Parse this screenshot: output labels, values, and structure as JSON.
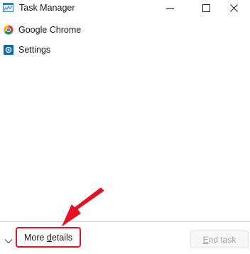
{
  "window": {
    "title": "Task Manager",
    "app_icon": "task-manager-icon"
  },
  "titlebar_buttons": {
    "minimize": "minimize-icon",
    "maximize": "maximize-icon",
    "close": "close-icon"
  },
  "processes": [
    {
      "name": "Google Chrome",
      "icon": "chrome-icon"
    },
    {
      "name": "Settings",
      "icon": "settings-icon"
    }
  ],
  "footer": {
    "more_details_prefix": "More ",
    "more_details_underlined": "d",
    "more_details_suffix": "etails",
    "end_task_underlined": "E",
    "end_task_suffix": "nd task"
  },
  "colors": {
    "highlight_red": "#e81123",
    "settings_blue": "#0067c0"
  }
}
